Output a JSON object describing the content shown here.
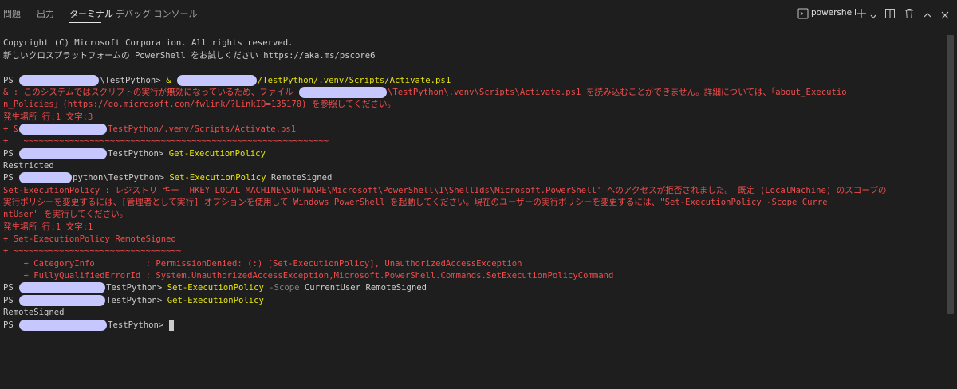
{
  "tabs": [
    "問題",
    "出力",
    "ターミナル",
    "デバッグ コンソール"
  ],
  "toolbar": {
    "terminal_name": "powershell",
    "icon_names": [
      "terminal-icon",
      "plus-icon",
      "chevron-down-icon",
      "trash-icon",
      "split-icon",
      "maximize-icon",
      "close-icon"
    ]
  },
  "terminal": {
    "l1": "Copyright (C) Microsoft Corporation. All rights reserved.",
    "l2": "新しいクロスプラットフォームの PowerShell をお試しください https://aka.ms/pscore6",
    "l3a": "PS ",
    "l3b": "\\TestPython> ",
    "l3c": "& ",
    "l3d": "/TestPython/.venv/Scripts/Activate.ps1",
    "l4a": "& : このシステムではスクリプトの実行が無効になっているため、ファイル ",
    "l4b": "\\TestPython\\.venv\\Scripts\\Activate.ps1 を読み込むことができません。詳細については、「about_Executio",
    "l5": "n_Policies」(https://go.microsoft.com/fwlink/?LinkID=135170) を参照してください。",
    "l6": "発生場所 行:1 文字:3",
    "l7a": "+ &",
    "l7b": "TestPython/.venv/Scripts/Activate.ps1",
    "l8": "+   ~~~~~~~~~~~~~~~~~~~~~~~~~~~~~~~~~~~~~~~~~~~~~~~~~~~~~~~~~~~~",
    "l9a": "PS ",
    "l9b": "TestPython> ",
    "l9c": "Get-ExecutionPolicy",
    "l10": "Restricted",
    "l11a": "PS ",
    "l11b": "python\\TestPython> ",
    "l11c": "Set-ExecutionPolicy",
    "l11d": " RemoteSigned",
    "l12": "Set-ExecutionPolicy : レジストリ キー 'HKEY_LOCAL_MACHINE\\SOFTWARE\\Microsoft\\PowerShell\\1\\ShellIds\\Microsoft.PowerShell' へのアクセスが拒否されました。 既定 (LocalMachine) のスコープの",
    "l13": "実行ポリシーを変更するには、[管理者として実行] オプションを使用して Windows PowerShell を起動してください。現在のユーザーの実行ポリシーを変更するには、\"Set-ExecutionPolicy -Scope Curre",
    "l14": "ntUser\" を実行してください。",
    "l15": "発生場所 行:1 文字:1",
    "l16": "+ Set-ExecutionPolicy RemoteSigned",
    "l17": "+ ~~~~~~~~~~~~~~~~~~~~~~~~~~~~~~~~~",
    "l18": "    + CategoryInfo          : PermissionDenied: (:) [Set-ExecutionPolicy], UnauthorizedAccessException",
    "l19": "    + FullyQualifiedErrorId : System.UnauthorizedAccessException,Microsoft.PowerShell.Commands.SetExecutionPolicyCommand",
    "l20a": "PS ",
    "l20b": "TestPython> ",
    "l20c": "Set-ExecutionPolicy",
    "l20d": " -Scope",
    "l20e": " CurrentUser RemoteSigned",
    "l21a": "PS ",
    "l21b": "TestPython> ",
    "l21c": "Get-ExecutionPolicy",
    "l22": "RemoteSigned",
    "l23a": "PS ",
    "l23b": "TestPython> "
  }
}
